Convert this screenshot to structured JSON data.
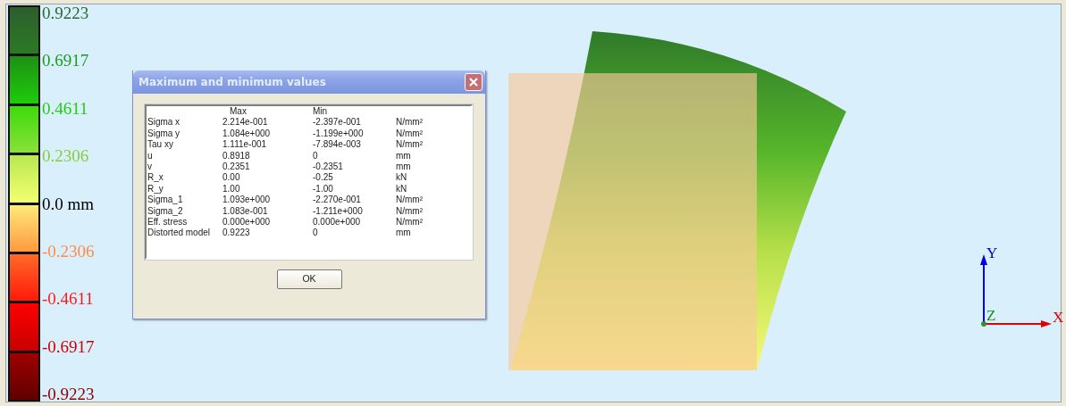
{
  "legend": {
    "labels": [
      {
        "text": "0.9223",
        "color": "#2e6b2e"
      },
      {
        "text": "0.6917",
        "color": "#1f9a1f"
      },
      {
        "text": "0.4611",
        "color": "#22cc11"
      },
      {
        "text": "0.2306",
        "color": "#86cc3c"
      },
      {
        "text": "0.0 mm",
        "color": "#000000"
      },
      {
        "text": "-0.2306",
        "color": "#ff8c4a"
      },
      {
        "text": "-0.4611",
        "color": "#ff1a1a"
      },
      {
        "text": "-0.6917",
        "color": "#cc0000"
      },
      {
        "text": "-0.9223",
        "color": "#8b0000"
      }
    ]
  },
  "dialog": {
    "title": "Maximum and minimum values",
    "columns": {
      "max": "Max",
      "min": "Min"
    },
    "rows": [
      {
        "label": "Sigma x",
        "max": "2.214e-001",
        "min": "-2.397e-001",
        "unit": "N/mm²"
      },
      {
        "label": "Sigma y",
        "max": "1.084e+000",
        "min": "-1.199e+000",
        "unit": "N/mm²"
      },
      {
        "label": "Tau xy",
        "max": "1.111e-001",
        "min": "-7.894e-003",
        "unit": "N/mm²"
      },
      {
        "label": "u",
        "max": "0.8918",
        "min": "0",
        "unit": "mm"
      },
      {
        "label": "v",
        "max": "0.2351",
        "min": "-0.2351",
        "unit": "mm"
      },
      {
        "label": "R_x",
        "max": "0.00",
        "min": "-0.25",
        "unit": "kN"
      },
      {
        "label": "R_y",
        "max": "1.00",
        "min": "-1.00",
        "unit": "kN"
      },
      {
        "label": "Sigma_1",
        "max": "1.093e+000",
        "min": "-2.270e-001",
        "unit": "N/mm²"
      },
      {
        "label": "Sigma_2",
        "max": "1.083e-001",
        "min": "-1.211e+000",
        "unit": "N/mm²"
      },
      {
        "label": "Eff. stress",
        "max": "0.000e+000",
        "min": "0.000e+000",
        "unit": "N/mm²"
      },
      {
        "label": "Distorted model",
        "max": "0.9223",
        "min": "0",
        "unit": "mm"
      }
    ],
    "ok_button": "OK"
  },
  "axes": {
    "x": "X",
    "y": "Y",
    "z": "Z"
  }
}
